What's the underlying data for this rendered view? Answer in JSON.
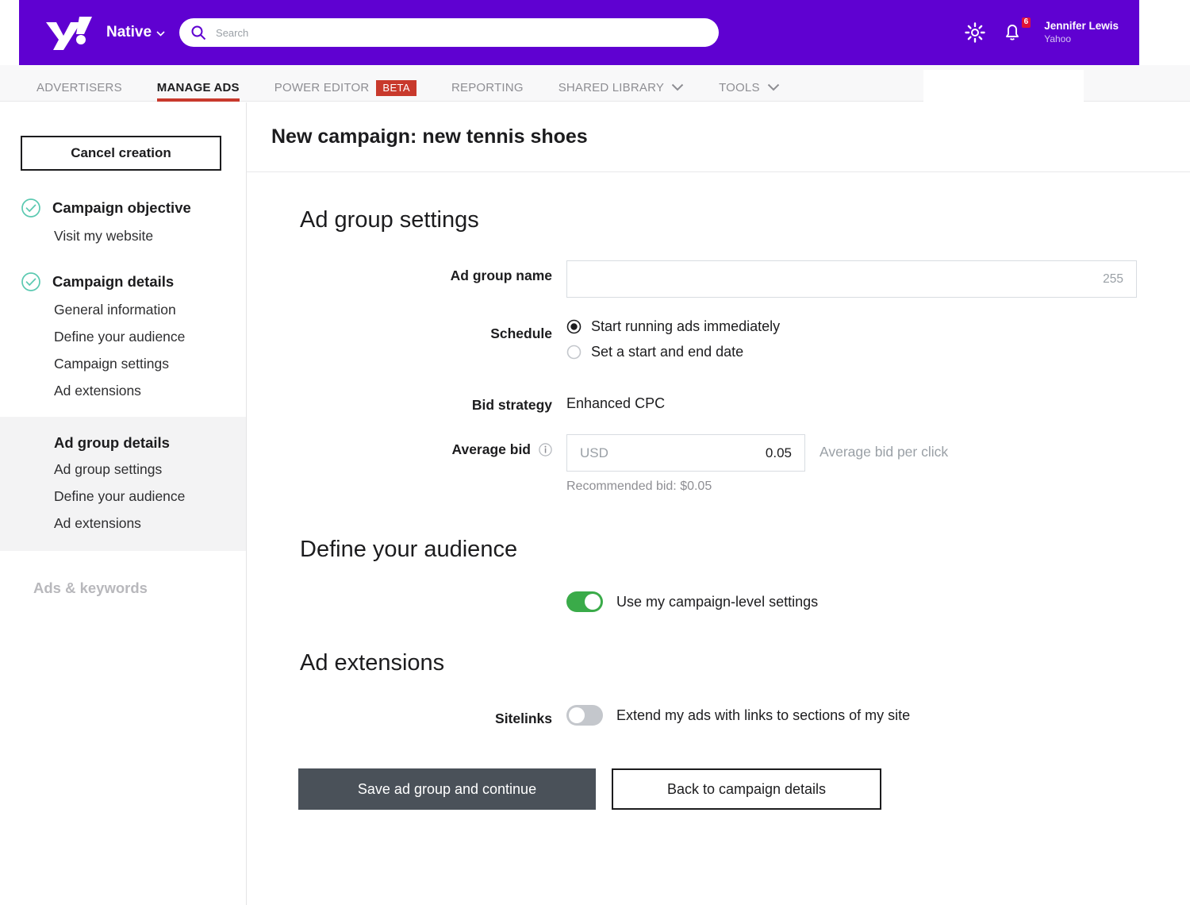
{
  "colors": {
    "brand_purple": "#5f01d1",
    "beta_red": "#c8392c",
    "badge_red": "#e0113a",
    "check_teal": "#5bc9b1",
    "toggle_on_green": "#3aab49",
    "toggle_off_gray": "#c4c7cc",
    "primary_btn_slate": "#4a5159"
  },
  "header": {
    "logo": "yahoo-logo",
    "brand": "Native",
    "brand_chevron": "chevron-down-icon",
    "search": {
      "icon": "search-icon",
      "value": "",
      "placeholder": "Search"
    },
    "gear_icon": "gear-icon",
    "bell_icon": "bell-icon",
    "notification_count": "6",
    "user_name": "Jennifer Lewis",
    "user_org": "Yahoo"
  },
  "nav": {
    "items": [
      {
        "label": "ADVERTISERS",
        "active": false,
        "badge": null,
        "chevron": false
      },
      {
        "label": "MANAGE ADS",
        "active": true,
        "badge": null,
        "chevron": false
      },
      {
        "label": "POWER EDITOR",
        "active": false,
        "badge": "BETA",
        "chevron": false
      },
      {
        "label": "REPORTING",
        "active": false,
        "badge": null,
        "chevron": false
      },
      {
        "label": "SHARED LIBRARY",
        "active": false,
        "badge": null,
        "chevron": true
      },
      {
        "label": "TOOLS",
        "active": false,
        "badge": null,
        "chevron": true
      }
    ]
  },
  "sidebar": {
    "cancel_label": "Cancel creation",
    "groups": [
      {
        "title": "Campaign objective",
        "completed": true,
        "items": [
          "Visit my website"
        ]
      },
      {
        "title": "Campaign details",
        "completed": true,
        "items": [
          "General information",
          "Define your audience",
          "Campaign settings",
          "Ad extensions"
        ]
      },
      {
        "title": "Ad group details",
        "completed": false,
        "current": true,
        "items": [
          "Ad group settings",
          "Define your audience",
          "Ad extensions"
        ]
      }
    ],
    "disabled_step": "Ads & keywords"
  },
  "main": {
    "page_title": "New campaign: new tennis shoes",
    "sections": {
      "ad_group_settings": {
        "heading": "Ad group settings",
        "ad_group_name": {
          "label": "Ad group name",
          "value": "",
          "placeholder": "",
          "char_counter": "255"
        },
        "schedule": {
          "label": "Schedule",
          "options": [
            {
              "label": "Start running ads immediately",
              "selected": true
            },
            {
              "label": "Set a start and end date",
              "selected": false
            }
          ]
        },
        "bid_strategy": {
          "label": "Bid strategy",
          "value": "Enhanced CPC"
        },
        "average_bid": {
          "label": "Average bid",
          "info_icon": "info-icon",
          "currency": "USD",
          "value": "0.05",
          "hint_right": "Average bid per click",
          "recommended": "Recommended bid: $0.05"
        }
      },
      "define_audience": {
        "heading": "Define your audience",
        "toggle": {
          "label": "Use my campaign-level settings",
          "on": true
        }
      },
      "ad_extensions": {
        "heading": "Ad extensions",
        "sitelinks": {
          "label": "Sitelinks",
          "description": "Extend my ads with links to sections of my site",
          "on": false
        }
      }
    },
    "buttons": {
      "primary": "Save ad group and continue",
      "secondary": "Back to campaign details"
    }
  }
}
